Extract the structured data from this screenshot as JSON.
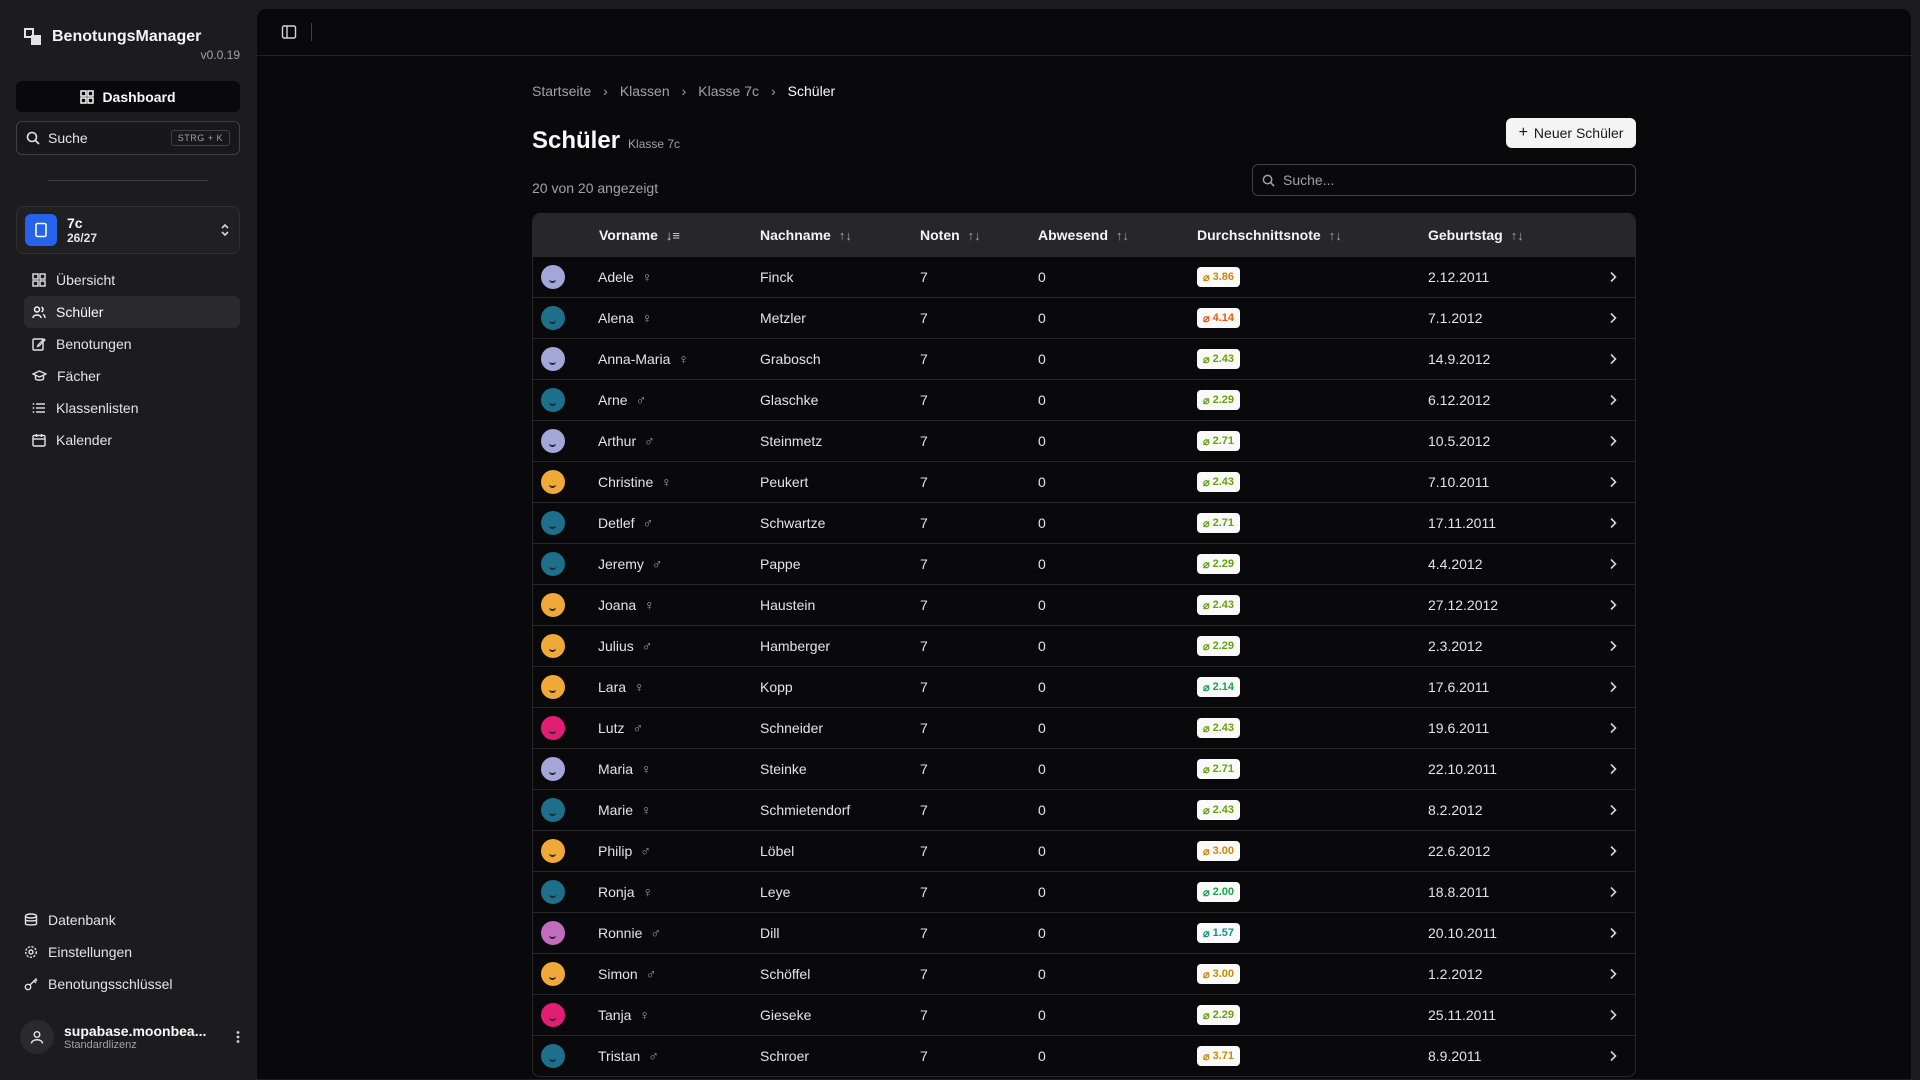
{
  "app": {
    "name": "BenotungsManager",
    "version": "v0.0.19"
  },
  "sidebar": {
    "dashboard": "Dashboard",
    "search": {
      "label": "Suche",
      "shortcut": "STRG + K"
    },
    "class": {
      "name": "7c",
      "year": "26/27"
    },
    "nav": [
      {
        "label": "Übersicht",
        "icon": "grid-icon",
        "active": false
      },
      {
        "label": "Schüler",
        "icon": "users-icon",
        "active": true
      },
      {
        "label": "Benotungen",
        "icon": "edit-icon",
        "active": false
      },
      {
        "label": "Fächer",
        "icon": "graduation-cap-icon",
        "active": false
      },
      {
        "label": "Klassenlisten",
        "icon": "list-icon",
        "active": false
      },
      {
        "label": "Kalender",
        "icon": "calendar-icon",
        "active": false
      }
    ],
    "bottom_nav": [
      {
        "label": "Datenbank",
        "icon": "database-icon"
      },
      {
        "label": "Einstellungen",
        "icon": "gear-icon"
      },
      {
        "label": "Benotungsschlüssel",
        "icon": "key-icon"
      }
    ],
    "user": {
      "name": "supabase.moonbea...",
      "license": "Standardlizenz"
    }
  },
  "breadcrumb": [
    "Startseite",
    "Klassen",
    "Klasse 7c",
    "Schüler"
  ],
  "page": {
    "title": "Schüler",
    "subtitle": "Klasse 7c",
    "new_button": "Neuer Schüler",
    "count": "20 von 20 angezeigt",
    "search_placeholder": "Suche..."
  },
  "table": {
    "columns": [
      "Vorname",
      "Nachname",
      "Noten",
      "Abwesend",
      "Durchschnittsnote",
      "Geburtstag"
    ],
    "rows": [
      {
        "first": "Adele",
        "gender": "♀",
        "last": "Finck",
        "grades": "7",
        "absent": "0",
        "avg": "3.86",
        "birthday": "2.12.2011",
        "avatar": "#a5a6d8",
        "grade_color": "#ca8a04"
      },
      {
        "first": "Alena",
        "gender": "♀",
        "last": "Metzler",
        "grades": "7",
        "absent": "0",
        "avg": "4.14",
        "birthday": "7.1.2012",
        "avatar": "#1d6f8a",
        "grade_color": "#ea580c"
      },
      {
        "first": "Anna-Maria",
        "gender": "♀",
        "last": "Grabosch",
        "grades": "7",
        "absent": "0",
        "avg": "2.43",
        "birthday": "14.9.2012",
        "avatar": "#a5a6d8",
        "grade_color": "#65a30d"
      },
      {
        "first": "Arne",
        "gender": "♂",
        "last": "Glaschke",
        "grades": "7",
        "absent": "0",
        "avg": "2.29",
        "birthday": "6.12.2012",
        "avatar": "#1d6f8a",
        "grade_color": "#65a30d"
      },
      {
        "first": "Arthur",
        "gender": "♂",
        "last": "Steinmetz",
        "grades": "7",
        "absent": "0",
        "avg": "2.71",
        "birthday": "10.5.2012",
        "avatar": "#a5a6d8",
        "grade_color": "#65a30d"
      },
      {
        "first": "Christine",
        "gender": "♀",
        "last": "Peukert",
        "grades": "7",
        "absent": "0",
        "avg": "2.43",
        "birthday": "7.10.2011",
        "avatar": "#f0a938",
        "grade_color": "#65a30d"
      },
      {
        "first": "Detlef",
        "gender": "♂",
        "last": "Schwartze",
        "grades": "7",
        "absent": "0",
        "avg": "2.71",
        "birthday": "17.11.2011",
        "avatar": "#1d6f8a",
        "grade_color": "#65a30d"
      },
      {
        "first": "Jeremy",
        "gender": "♂",
        "last": "Pappe",
        "grades": "7",
        "absent": "0",
        "avg": "2.29",
        "birthday": "4.4.2012",
        "avatar": "#1d6f8a",
        "grade_color": "#65a30d"
      },
      {
        "first": "Joana",
        "gender": "♀",
        "last": "Haustein",
        "grades": "7",
        "absent": "0",
        "avg": "2.43",
        "birthday": "27.12.2012",
        "avatar": "#f0a938",
        "grade_color": "#65a30d"
      },
      {
        "first": "Julius",
        "gender": "♂",
        "last": "Hamberger",
        "grades": "7",
        "absent": "0",
        "avg": "2.29",
        "birthday": "2.3.2012",
        "avatar": "#f0a938",
        "grade_color": "#65a30d"
      },
      {
        "first": "Lara",
        "gender": "♀",
        "last": "Kopp",
        "grades": "7",
        "absent": "0",
        "avg": "2.14",
        "birthday": "17.6.2011",
        "avatar": "#f0a938",
        "grade_color": "#16a34a"
      },
      {
        "first": "Lutz",
        "gender": "♂",
        "last": "Schneider",
        "grades": "7",
        "absent": "0",
        "avg": "2.43",
        "birthday": "19.6.2011",
        "avatar": "#e11d74",
        "grade_color": "#65a30d"
      },
      {
        "first": "Maria",
        "gender": "♀",
        "last": "Steinke",
        "grades": "7",
        "absent": "0",
        "avg": "2.71",
        "birthday": "22.10.2011",
        "avatar": "#a5a6d8",
        "grade_color": "#65a30d"
      },
      {
        "first": "Marie",
        "gender": "♀",
        "last": "Schmietendorf",
        "grades": "7",
        "absent": "0",
        "avg": "2.43",
        "birthday": "8.2.2012",
        "avatar": "#1d6f8a",
        "grade_color": "#65a30d"
      },
      {
        "first": "Philip",
        "gender": "♂",
        "last": "Löbel",
        "grades": "7",
        "absent": "0",
        "avg": "3.00",
        "birthday": "22.6.2012",
        "avatar": "#f0a938",
        "grade_color": "#ca8a04"
      },
      {
        "first": "Ronja",
        "gender": "♀",
        "last": "Leye",
        "grades": "7",
        "absent": "0",
        "avg": "2.00",
        "birthday": "18.8.2011",
        "avatar": "#1d6f8a",
        "grade_color": "#16a34a"
      },
      {
        "first": "Ronnie",
        "gender": "♂",
        "last": "Dill",
        "grades": "7",
        "absent": "0",
        "avg": "1.57",
        "birthday": "20.10.2011",
        "avatar": "#c26cc0",
        "grade_color": "#0d9488"
      },
      {
        "first": "Simon",
        "gender": "♂",
        "last": "Schöffel",
        "grades": "7",
        "absent": "0",
        "avg": "3.00",
        "birthday": "1.2.2012",
        "avatar": "#f0a938",
        "grade_color": "#ca8a04"
      },
      {
        "first": "Tanja",
        "gender": "♀",
        "last": "Gieseke",
        "grades": "7",
        "absent": "0",
        "avg": "2.29",
        "birthday": "25.11.2011",
        "avatar": "#e11d74",
        "grade_color": "#65a30d"
      },
      {
        "first": "Tristan",
        "gender": "♂",
        "last": "Schroer",
        "grades": "7",
        "absent": "0",
        "avg": "3.71",
        "birthday": "8.9.2011",
        "avatar": "#1d6f8a",
        "grade_color": "#ca8a04"
      }
    ]
  }
}
